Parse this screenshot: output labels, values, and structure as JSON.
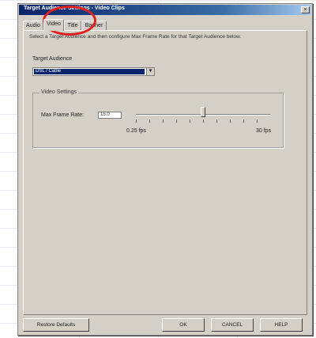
{
  "window": {
    "title": "Target Audience Settings - Video Clips",
    "close_label": "×"
  },
  "tabs": [
    {
      "label": "Audio"
    },
    {
      "label": "Video"
    },
    {
      "label": "Title"
    },
    {
      "label": "Banner"
    }
  ],
  "panel": {
    "description": "Select a Target Audience and then configure Max Frame Rate for that Target Audience below.",
    "target_audience_label": "Target Audience",
    "target_audience_value": "DSL / Cable",
    "video_settings": {
      "group_title": "Video Settings",
      "max_frame_rate_label": "Max Frame Rate:",
      "max_frame_rate_value": "15.0",
      "slider_min_label": "0.25 fps",
      "slider_max_label": "30 fps",
      "slider_level_fraction": 0.5
    }
  },
  "buttons": {
    "restore_defaults": "Restore Defaults",
    "ok": "OK",
    "cancel": "CANCEL",
    "help": "HELP"
  },
  "annotation": {
    "color": "#e02020"
  }
}
